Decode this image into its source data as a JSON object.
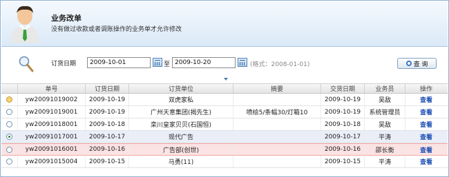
{
  "header": {
    "title": "业务改单",
    "subtitle": "没有做过收款或者调账操作的业务单才允许修改"
  },
  "search": {
    "label": "订货日期",
    "from": "2009-10-01",
    "to_label": "至",
    "to": "2009-10-20",
    "format_hint": "(格式：2008-01-01)",
    "query_button": "查 询"
  },
  "table": {
    "columns": [
      "",
      "单号",
      "订货日期",
      "订货单位",
      "摘要",
      "交货日期",
      "业务员",
      "操作"
    ],
    "rows": [
      {
        "radio": "hover",
        "order_no": "yw20091019002",
        "order_date": "2009-10-19",
        "customer": "双虎家私",
        "summary": "",
        "delivery_date": "2009-10-19",
        "salesman": "吴敌",
        "action": "查看"
      },
      {
        "radio": "off",
        "order_no": "yw20091019001",
        "order_date": "2009-10-19",
        "customer": "广州天意集团(揭先生)",
        "summary": "喷绘5/条幅30/灯箱10",
        "delivery_date": "2009-10-19",
        "salesman": "系统管理员",
        "action": "查看"
      },
      {
        "radio": "off",
        "order_no": "yw20091018001",
        "order_date": "2009-10-18",
        "customer": "栾川皇家贝贝(石国恒)",
        "summary": "",
        "delivery_date": "2009-10-18",
        "salesman": "吴敌",
        "action": "查看"
      },
      {
        "radio": "checked",
        "order_no": "yw20091017001",
        "order_date": "2009-10-17",
        "customer": "现代广告",
        "summary": "",
        "delivery_date": "2009-10-17",
        "salesman": "平涛",
        "action": "查看"
      },
      {
        "radio": "off",
        "order_no": "yw20091016001",
        "order_date": "2009-10-16",
        "customer": "广告部(创世)",
        "summary": "",
        "delivery_date": "2009-10-16",
        "salesman": "邵长衡",
        "action": "查看"
      },
      {
        "radio": "off",
        "order_no": "yw20091015004",
        "order_date": "2009-10-15",
        "customer": "马勇(11)",
        "summary": "",
        "delivery_date": "2009-10-15",
        "salesman": "平涛",
        "action": "查看"
      }
    ]
  },
  "icons": {
    "avatar": "user-avatar-icon",
    "search": "magnifier-icon",
    "calendar": "calendar-icon",
    "collapse": "triangle-down-icon"
  },
  "colors": {
    "header_bg": "#dbe9f7",
    "link": "#1d4fb3",
    "selected_row": "#e9eef7",
    "highlight_row": "#fbe3e3"
  }
}
